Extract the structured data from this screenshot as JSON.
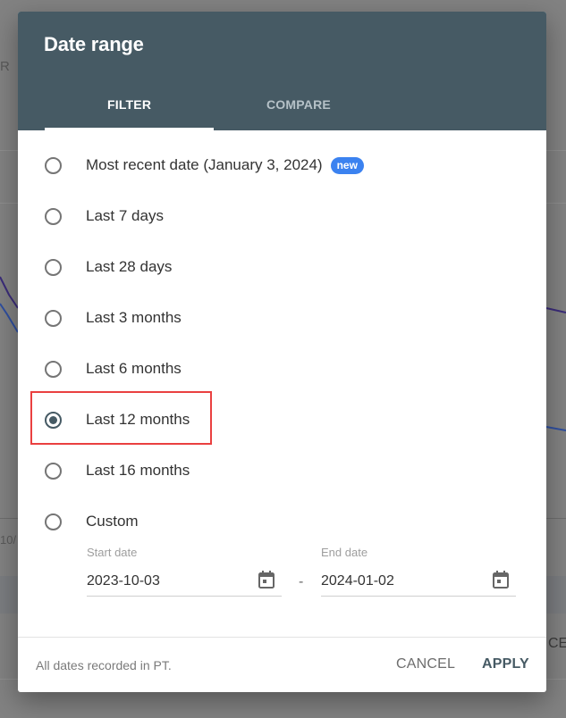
{
  "background": {
    "partial_text_top": "R",
    "partial_axis_label": "10/",
    "partial_text_right": "CE"
  },
  "dialog": {
    "title": "Date range",
    "tabs": [
      {
        "label": "FILTER",
        "active": true
      },
      {
        "label": "COMPARE",
        "active": false
      }
    ],
    "options": [
      {
        "label": "Most recent date (January 3, 2024)",
        "badge": "new",
        "selected": false
      },
      {
        "label": "Last 7 days",
        "selected": false
      },
      {
        "label": "Last 28 days",
        "selected": false
      },
      {
        "label": "Last 3 months",
        "selected": false
      },
      {
        "label": "Last 6 months",
        "selected": false
      },
      {
        "label": "Last 12 months",
        "selected": true
      },
      {
        "label": "Last 16 months",
        "selected": false
      },
      {
        "label": "Custom",
        "selected": false
      }
    ],
    "custom": {
      "start_label": "Start date",
      "start_value": "2023-10-03",
      "separator": "-",
      "end_label": "End date",
      "end_value": "2024-01-02"
    },
    "footnote": "All dates recorded in PT.",
    "cancel_label": "CANCEL",
    "apply_label": "APPLY"
  },
  "colors": {
    "header": "#465a64",
    "badge": "#3b82f0",
    "highlight": "#ea4040"
  }
}
